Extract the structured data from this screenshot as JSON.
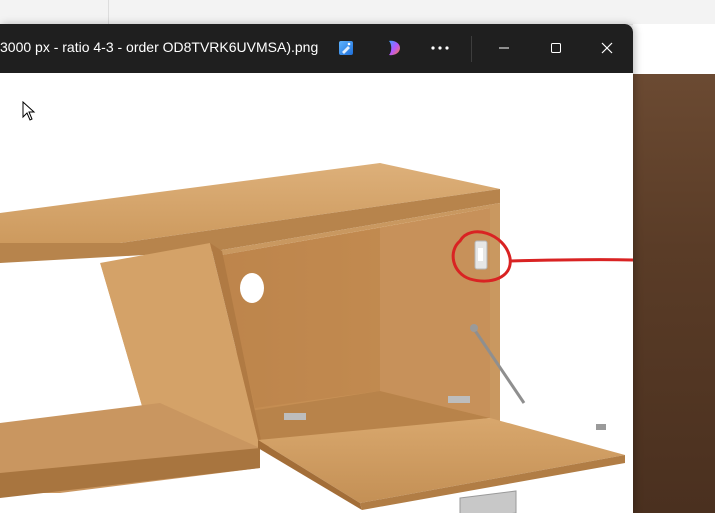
{
  "viewer": {
    "title": "3000 px - ratio 4-3 - order OD8TVRK6UVMSA).png",
    "toolbar": {
      "edit_icon": "edit-image-icon",
      "copilot_icon": "copilot-icon",
      "more_icon": "more-options-icon",
      "minimize_icon": "minimize-icon",
      "maximize_icon": "maximize-icon",
      "close_icon": "close-icon"
    }
  },
  "image": {
    "subject": "wooden TV cabinet with open drop-down door, hinge highlighted with red circle",
    "colors": {
      "wood_light": "#d3a36b",
      "wood_mid": "#c48f55",
      "wood_dark": "#a7733d",
      "annotation": "#d92323"
    }
  },
  "colors": {
    "titlebar": "#1f1f1f",
    "title_text": "#ffffff",
    "background": "#f7f7f7"
  }
}
